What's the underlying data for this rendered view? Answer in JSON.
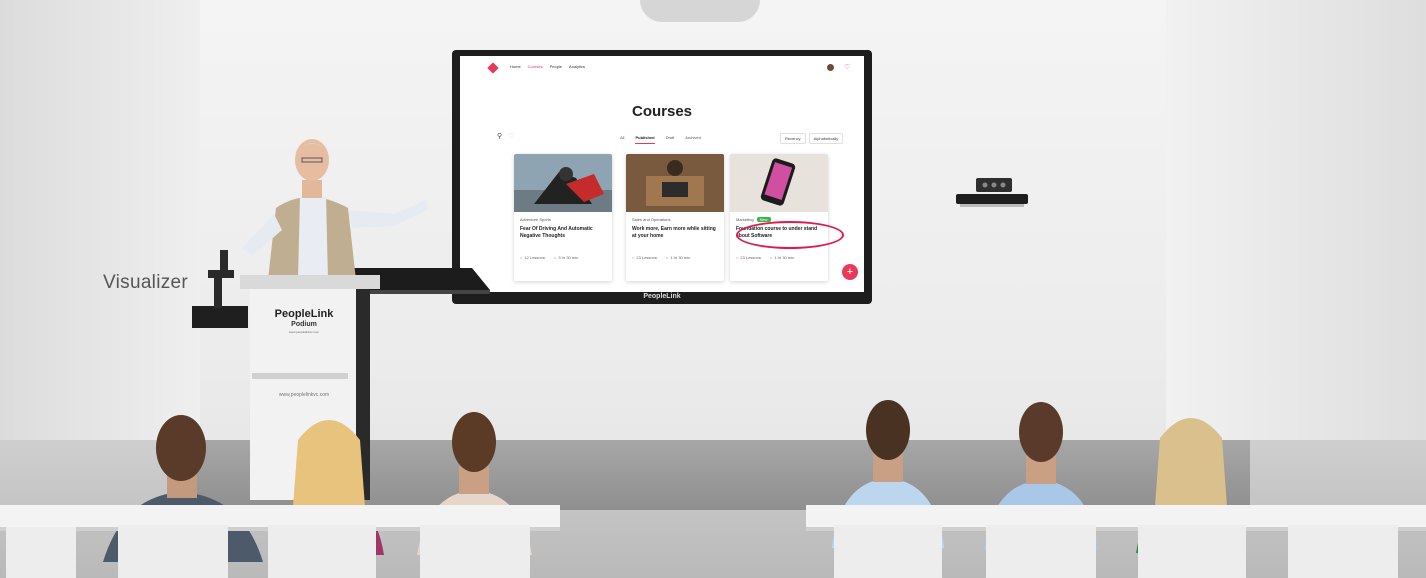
{
  "label": "Visualizer",
  "screen": {
    "nav": [
      "Home",
      "Courses",
      "People",
      "Analytics"
    ],
    "active_nav": "Courses",
    "title": "Courses",
    "tabs": [
      "All",
      "Published",
      "Draft",
      "Archived"
    ],
    "active_tab": "Published",
    "sort": [
      "Recency",
      "Alphabetically"
    ],
    "fab": "+",
    "cards": [
      {
        "category": "Adventure Sports",
        "title": "Fear Of Driving And Automatic Negative Thoughts",
        "lessons": "12 Lessons",
        "duration": "3 hr 30 min"
      },
      {
        "category": "Sales and Operations",
        "title": "Work more, Earn more while sitting at your home",
        "lessons": "23 Lessons",
        "duration": "1 hr 30 min"
      },
      {
        "category": "Marketing",
        "badge": "New",
        "title": "Foundation course to under stand about Software",
        "lessons": "23 Lessons",
        "duration": "1 hr 30 min"
      }
    ]
  },
  "monitor_brand": "PeopleLink",
  "podium": {
    "brand": "PeopleLink",
    "product": "Podium",
    "site": "www.peoplelinkvc.com",
    "url": "www.peoplelinkvc.com"
  },
  "colors": {
    "accent": "#e8395a",
    "highlight": "#e01a4f",
    "badge": "#3bb54a"
  }
}
